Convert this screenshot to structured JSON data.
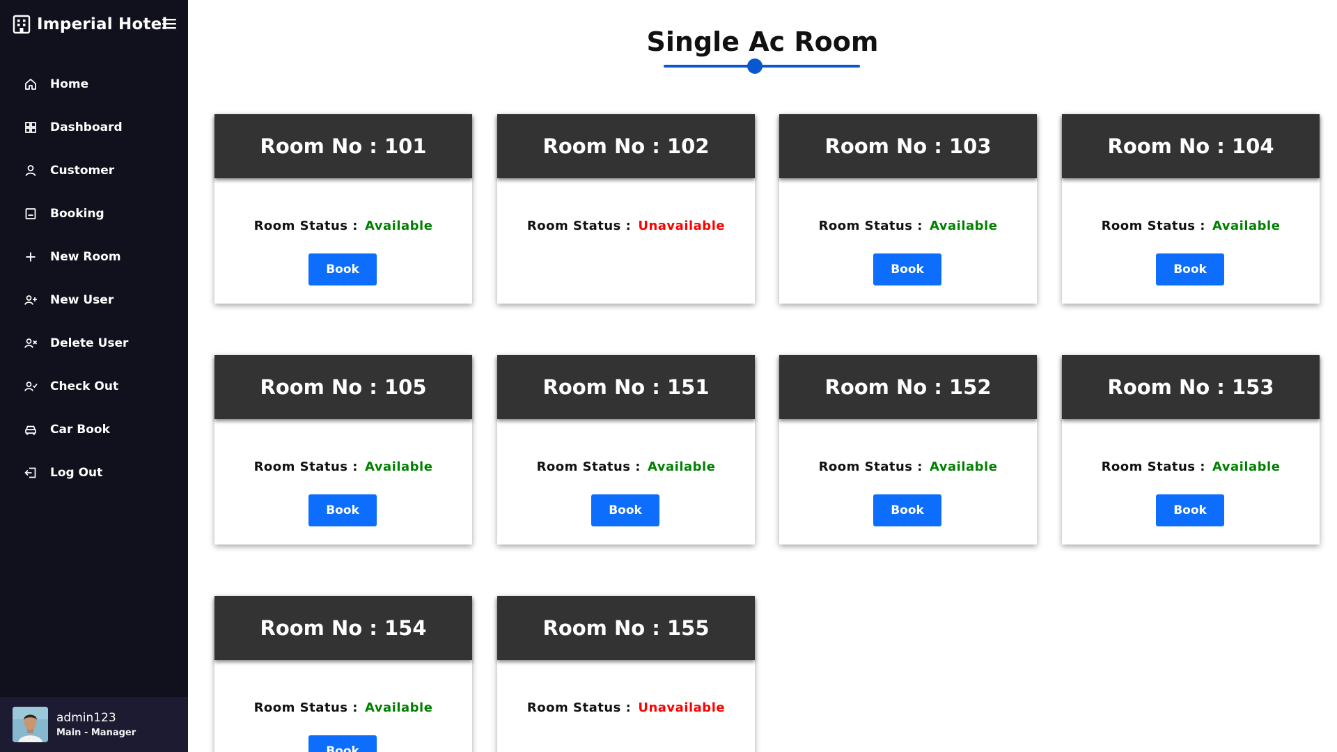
{
  "sidebar": {
    "brand": "Imperial Hotel",
    "items": [
      {
        "label": "Home",
        "icon": "home-icon"
      },
      {
        "label": "Dashboard",
        "icon": "grid-icon"
      },
      {
        "label": "Customer",
        "icon": "user-icon"
      },
      {
        "label": "Booking",
        "icon": "booking-icon"
      },
      {
        "label": "New Room",
        "icon": "plus-icon"
      },
      {
        "label": "New User",
        "icon": "user-plus-icon"
      },
      {
        "label": "Delete User",
        "icon": "user-x-icon"
      },
      {
        "label": "Check Out",
        "icon": "user-check-icon"
      },
      {
        "label": "Car Book",
        "icon": "car-icon"
      },
      {
        "label": "Log Out",
        "icon": "logout-icon"
      }
    ],
    "profile": {
      "name": "admin123",
      "role": "Main - Manager"
    }
  },
  "main": {
    "title": "Single Ac Room",
    "status_label": "Room Status :",
    "book_label": "Book",
    "rooms": [
      {
        "title": "Room No : 101",
        "status": "Available",
        "bookable": true
      },
      {
        "title": "Room No : 102",
        "status": "Unavailable",
        "bookable": false
      },
      {
        "title": "Room No : 103",
        "status": "Available",
        "bookable": true
      },
      {
        "title": "Room No : 104",
        "status": "Available",
        "bookable": true
      },
      {
        "title": "Room No : 105",
        "status": "Available",
        "bookable": true
      },
      {
        "title": "Room No : 151",
        "status": "Available",
        "bookable": true
      },
      {
        "title": "Room No : 152",
        "status": "Available",
        "bookable": true
      },
      {
        "title": "Room No : 153",
        "status": "Available",
        "bookable": true
      },
      {
        "title": "Room No : 154",
        "status": "Available",
        "bookable": true
      },
      {
        "title": "Room No : 155",
        "status": "Unavailable",
        "bookable": false
      }
    ]
  },
  "colors": {
    "sidebar_bg": "#11101d",
    "profile_bg": "#1d1b31",
    "card_header": "#333333",
    "available": "#008000",
    "unavailable": "#ff0000",
    "accent": "#0d6efd"
  }
}
